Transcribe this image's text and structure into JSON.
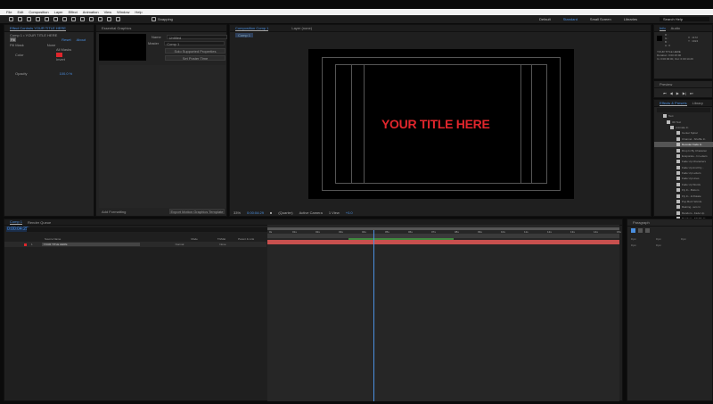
{
  "menu": [
    "File",
    "Edit",
    "Composition",
    "Layer",
    "Effect",
    "Animation",
    "View",
    "Window",
    "Help"
  ],
  "toolbar": {
    "snapping": "Snapping"
  },
  "workspaces": [
    {
      "label": "Default",
      "active": false
    },
    {
      "label": "Standard",
      "active": true
    },
    {
      "label": "Small Screen",
      "active": false
    },
    {
      "label": "Libraries",
      "active": false
    }
  ],
  "search_help": "Search Help",
  "effect_controls": {
    "tab": "Effect Controls YOUR TITLE HERE",
    "subtitle": "Comp 1 • YOUR TITLE HERE",
    "fx": "Fill",
    "reset": "Reset",
    "about": "About",
    "fill_mask": "Fill Mask",
    "fill_mask_value": "None",
    "all_masks": "All Masks",
    "color": "Color",
    "invert": "Invert",
    "opacity": "Opacity",
    "opacity_value": "100.0 %",
    "color_value": "#e0262c"
  },
  "essential_graphics": {
    "tab": "Essential Graphics",
    "name_label": "Name",
    "name_value": "Untitled",
    "master_label": "Master",
    "master_value": "Comp 1",
    "solo_btn": "Solo Supported Properties",
    "poster_btn": "Set Poster Time",
    "add_formatting": "Add Formatting",
    "export_btn": "Export Motion Graphics Template"
  },
  "composition": {
    "tab": "Composition Comp 1",
    "layer_tab": "Layer (none)",
    "comp_chip": "Comp 1",
    "title_text": "YOUR TITLE HERE",
    "zoom": "33%",
    "timecode": "0:00:04:29",
    "resolution": "(Quarter)",
    "camera": "Active Camera",
    "views": "1 View",
    "exposure": "+0.0"
  },
  "info": {
    "tab": "Info",
    "audio": "Audio",
    "rgb": [
      "R :",
      "G :",
      "B :",
      "A : 0"
    ],
    "xy": [
      "X : 1172",
      "Y : 1024"
    ],
    "lines": [
      "YOUR TITLE HERE",
      "Duration: 0:00:15:00",
      "In: 0:00:00:00, Out: 0:00:14:29"
    ]
  },
  "preview": {
    "tab": "Preview"
  },
  "effects_presets": {
    "tab": "Effects & Presets",
    "library": "Library",
    "tree": [
      "Text",
      "3D Text",
      "Animate In"
    ],
    "items": [
      "Center Spiral",
      "Channel...Shuffle In",
      "Decoder Fade In",
      "Drop In By Character",
      "Evaporate...In Letters",
      "Fade Up Characters",
      "Fade Up And Fly...",
      "Fade Up Letters",
      "Fade Up Lines",
      "Fade Up Words",
      "Fly In...Bottom",
      "Fly In...& Rotate",
      "Pop Buzz Words",
      "Raining...ters In",
      "Random...Fade Up",
      "Random...Shuffle In",
      "Random...Shuffle In",
      "Slow Fade On",
      "Smooth Move In"
    ],
    "selected_index": 2
  },
  "timeline": {
    "tabs": [
      "Comp 1",
      "Render Queue"
    ],
    "timecode": "0:00:04:29",
    "source_name": "Source Name",
    "mode": "Mode",
    "trkmat": "TrkMat",
    "parent": "Parent & Link",
    "layer_num": "1",
    "layer_name": "YOUR TITLE HERE",
    "layer_mode": "Normal",
    "layer_parent": "None",
    "ruler": [
      "0s",
      "01s",
      "02s",
      "03s",
      "04s",
      "05s",
      "06s",
      "07s",
      "08s",
      "09s",
      "10s",
      "11s",
      "12s",
      "13s",
      "14s",
      "15s"
    ],
    "playhead_fraction": 0.3,
    "work_area_start": 0.23,
    "work_area_end": 0.53,
    "layer_color": "#c8504e"
  },
  "paragraph": {
    "tab": "Paragraph",
    "indent": [
      "0 px",
      "0 px",
      "0 px",
      "0 px",
      "0 px"
    ]
  }
}
